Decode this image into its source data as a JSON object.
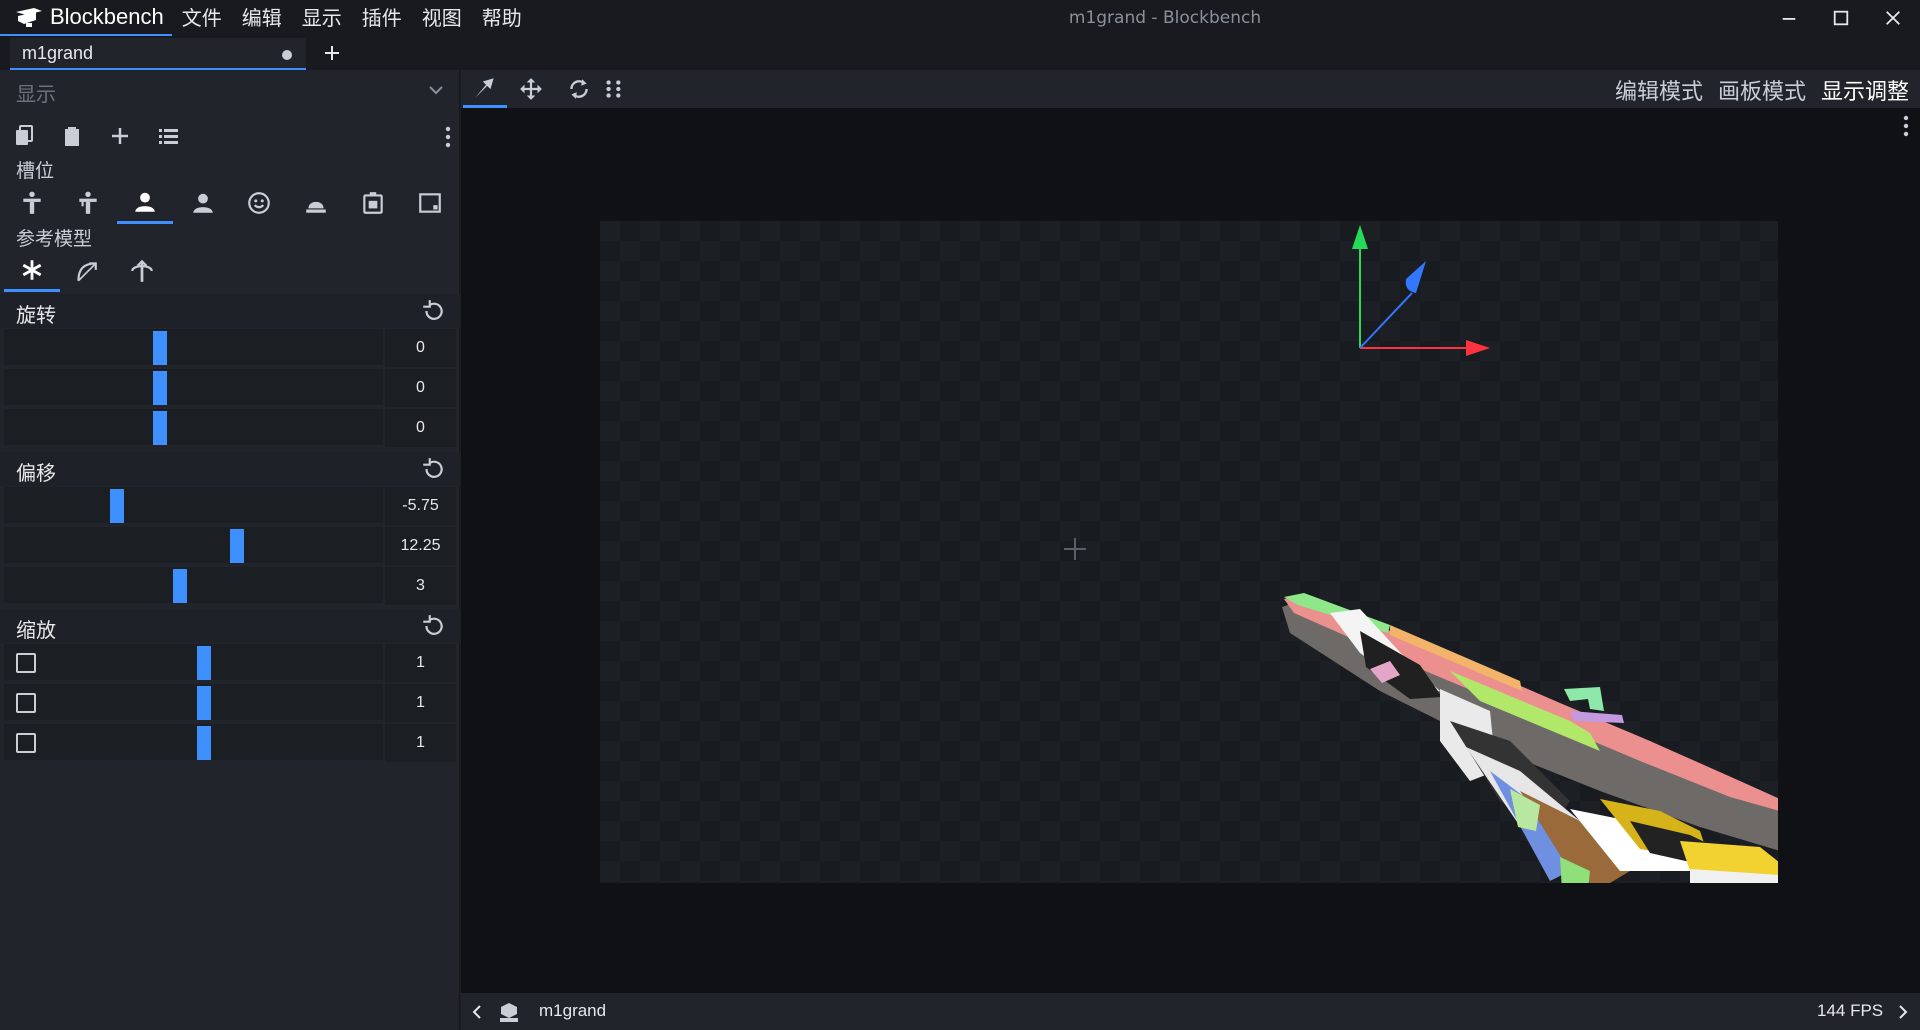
{
  "app": {
    "name": "Blockbench",
    "window_title": "m1grand - Blockbench",
    "menu": [
      "文件",
      "编辑",
      "显示",
      "插件",
      "视图",
      "帮助"
    ]
  },
  "tab": {
    "name": "m1grand"
  },
  "panel": {
    "select_label": "显示",
    "slot_label": "槽位",
    "reference_label": "参考模型",
    "rotation": {
      "label": "旋转",
      "values": [
        "0",
        "0",
        "0"
      ],
      "fractions": [
        0.416,
        0.416,
        0.416
      ]
    },
    "translation": {
      "label": "偏移",
      "values": [
        "-5.75",
        "12.25",
        "3"
      ],
      "fractions": [
        0.3,
        0.62,
        0.47
      ]
    },
    "scale": {
      "label": "缩放",
      "values": [
        "1",
        "1",
        "1"
      ],
      "fractions": [
        0.47,
        0.47,
        0.47
      ]
    }
  },
  "modes": {
    "edit": "编辑模式",
    "paint": "画板模式",
    "display": "显示调整"
  },
  "status": {
    "model_name": "m1grand",
    "fps": "144 FPS"
  },
  "colors": {
    "accent": "#3e90ff",
    "axis_x": "#ff3340",
    "axis_y": "#22dd55",
    "axis_z": "#3377ff"
  }
}
